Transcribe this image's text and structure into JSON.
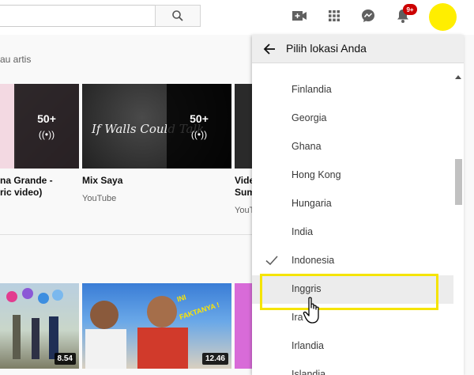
{
  "header": {
    "notification_count": "9+"
  },
  "background": {
    "section_label": "au artis",
    "cards": [
      {
        "title_line1": "na Grande -",
        "title_line2": "ric video)",
        "count": "50+"
      },
      {
        "title_line1": "Mix Saya",
        "subtitle": "YouTube",
        "thumb_text": "If Walls Could Talk",
        "count": "50+"
      },
      {
        "title_line1": "Vide",
        "title_line2": "Sum",
        "subtitle": "YouT"
      }
    ],
    "videos": [
      {
        "duration": "8.54"
      },
      {
        "duration": "12.46",
        "thumb_text_line1": "INI",
        "thumb_text_line2": "FAKTANYA !"
      }
    ]
  },
  "location_menu": {
    "title": "Pilih lokasi Anda",
    "items": [
      {
        "label": "Finlandia"
      },
      {
        "label": "Georgia"
      },
      {
        "label": "Ghana"
      },
      {
        "label": "Hong Kong"
      },
      {
        "label": "Hungaria"
      },
      {
        "label": "India"
      },
      {
        "label": "Indonesia",
        "selected": true
      },
      {
        "label": "Inggris",
        "hovered": true
      },
      {
        "label": "Ira"
      },
      {
        "label": "Irlandia"
      },
      {
        "label": "Islandia"
      }
    ]
  },
  "colors": {
    "highlight": "#f5e400",
    "avatar": "#ffee00",
    "badge": "#cc0000"
  }
}
